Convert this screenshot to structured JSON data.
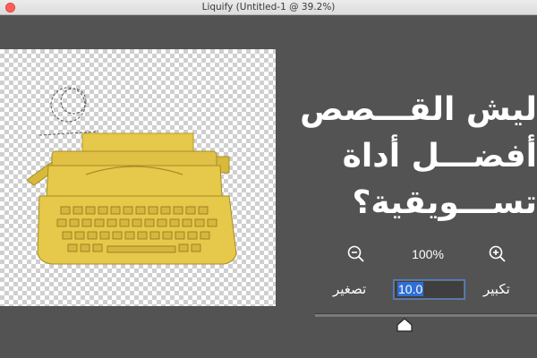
{
  "window": {
    "title": "Liquify (Untitled-1 @ 39.2%)"
  },
  "canvas": {
    "image_subject": "yellow typewriter"
  },
  "poster_text": {
    "line1": "ليش القـــصص",
    "line2": "أفضـــل أداة",
    "line3": "تســـويقية؟"
  },
  "controls": {
    "zoom_level": "100%",
    "size_value": "10.0",
    "shrink_label": "تصغير",
    "grow_label": "تكبير",
    "zoom_out_icon": "zoom-out-icon",
    "zoom_in_icon": "zoom-in-icon",
    "slider_value_fraction": 0.37
  },
  "colors": {
    "background": "#535353",
    "typewriter": "#e6c84a",
    "selection": "#2f6fd6"
  }
}
